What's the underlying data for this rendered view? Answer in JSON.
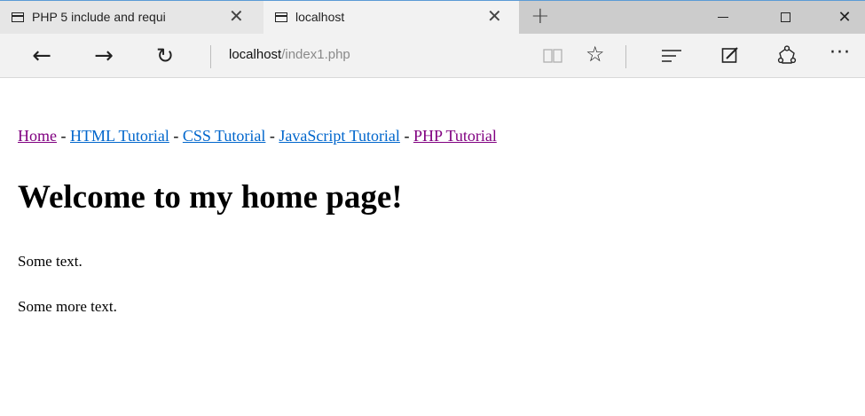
{
  "browser": {
    "tabs": [
      {
        "title": "PHP 5 include and requi",
        "close": "✕",
        "active": false
      },
      {
        "title": "localhost",
        "close": "✕",
        "active": true
      }
    ],
    "new_tab": "+",
    "window": {
      "close": "✕"
    },
    "nav": {
      "back": "←",
      "forward": "→",
      "refresh": "↻"
    },
    "address": {
      "host": "localhost",
      "path": "/index1.php"
    },
    "favorite_icon": "☆",
    "more_icon": "···",
    "accent": "#5b9bd5"
  },
  "page": {
    "links": [
      {
        "label": "Home",
        "state": "visited"
      },
      {
        "label": "HTML Tutorial",
        "state": "new"
      },
      {
        "label": "CSS Tutorial",
        "state": "new"
      },
      {
        "label": "JavaScript Tutorial",
        "state": "new"
      },
      {
        "label": "PHP Tutorial",
        "state": "visited"
      }
    ],
    "separator": " - ",
    "heading": "Welcome to my home page!",
    "paragraphs": [
      "Some text.",
      "Some more text."
    ]
  }
}
